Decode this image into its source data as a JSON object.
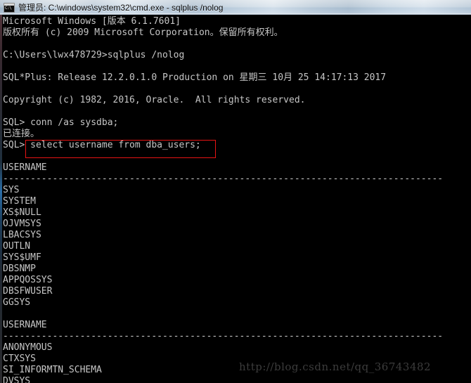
{
  "window": {
    "title": "管理员: C:\\windows\\system32\\cmd.exe - sqlplus  /nolog",
    "icon": "console-window-icon",
    "icon_text": "C:\\",
    "background_color": "#000000",
    "foreground_color": "#c6c6c6"
  },
  "annotation": {
    "box_color": "#e81414",
    "target_line": "select username from dba_users;"
  },
  "watermark": {
    "text": "http://blog.csdn.net/qq_36743482",
    "color": "#3c3c3c"
  },
  "console": {
    "lines": [
      "Microsoft Windows [版本 6.1.7601]",
      "版权所有 (c) 2009 Microsoft Corporation。保留所有权利。",
      "",
      "C:\\Users\\lwx478729>sqlplus /nolog",
      "",
      "SQL*Plus: Release 12.2.0.1.0 Production on 星期三 10月 25 14:17:13 2017",
      "",
      "Copyright (c) 1982, 2016, Oracle.  All rights reserved.",
      "",
      "SQL> conn /as sysdba;",
      "已连接。",
      "SQL> select username from dba_users;",
      "",
      "USERNAME",
      "--------------------------------------------------------------------------------",
      "SYS",
      "SYSTEM",
      "XS$NULL",
      "OJVMSYS",
      "LBACSYS",
      "OUTLN",
      "SYS$UMF",
      "DBSNMP",
      "APPQOSSYS",
      "DBSFWUSER",
      "GGSYS",
      "",
      "USERNAME",
      "--------------------------------------------------------------------------------",
      "ANONYMOUS",
      "CTXSYS",
      "SI_INFORMTN_SCHEMA",
      "DVSYS"
    ]
  }
}
